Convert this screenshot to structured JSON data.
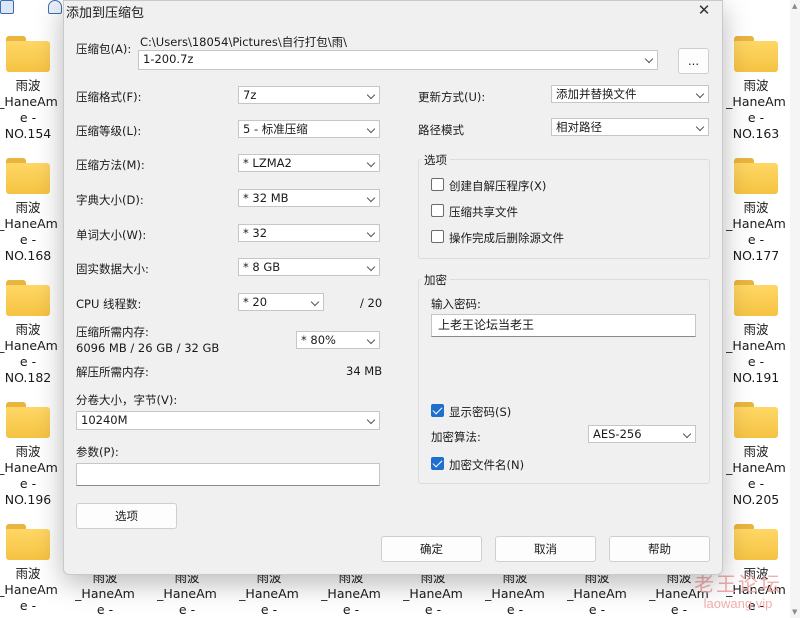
{
  "desktop": {
    "folders": [
      {
        "name": "雨波\n_HaneAm\ne -\nNO.154"
      },
      {
        "name": "雨波\n_HaneAm\ne -\nNO.168"
      },
      {
        "name": "雨波\n_HaneAm\ne -\nNO.182"
      },
      {
        "name": "雨波\n_HaneAm\ne -\nNO.196"
      },
      {
        "name": "雨波\n_HaneAm\ne -"
      },
      {
        "name": "雨波\n_HaneAm\ne -\nNO.163"
      },
      {
        "name": "雨波\n_HaneAm\ne -\nNO.177"
      },
      {
        "name": "雨波\n_HaneAm\ne -\nNO.191"
      },
      {
        "name": "雨波\n_HaneAm\ne -\nNO.205"
      },
      {
        "name": "雨波\n_HaneAm\ne -"
      }
    ],
    "bottom_row": [
      "雨波\n_HaneAm\ne -",
      "雨波\n_HaneAm\ne -",
      "雨波\n_HaneAm\ne -",
      "雨波\n_HaneAm\ne -",
      "雨波\n_HaneAm\ne -",
      "雨波\n_HaneAm\ne -",
      "雨波\n_HaneAm\ne -",
      "雨波\n_HaneAm\ne -"
    ],
    "watermark": {
      "line1": "老王论坛",
      "line2": "laowang.vip"
    }
  },
  "dialog": {
    "title": "添加到压缩包",
    "archive_label": "压缩包(A):",
    "archive_path": "C:\\Users\\18054\\Pictures\\自行打包\\雨\\",
    "archive_name": "1-200.7z",
    "browse_label": "...",
    "format_label": "压缩格式(F):",
    "format_value": "7z",
    "level_label": "压缩等级(L):",
    "level_value": "5 - 标准压缩",
    "method_label": "压缩方法(M):",
    "method_value": "*  LZMA2",
    "dict_label": "字典大小(D):",
    "dict_value": "*  32 MB",
    "word_label": "单词大小(W):",
    "word_value": "*  32",
    "solid_label": "固实数据大小:",
    "solid_value": "*  8 GB",
    "cpu_label": "CPU 线程数:",
    "cpu_value": "*  20",
    "cpu_total": "/ 20",
    "mem_comp_label": "压缩所需内存:",
    "mem_comp_value": "6096 MB / 26 GB / 32 GB",
    "mem_percent": "*  80%",
    "mem_decomp_label": "解压所需内存:",
    "mem_decomp_value": "34 MB",
    "split_label": "分卷大小，字节(V):",
    "split_value": "10240M",
    "params_label": "参数(P):",
    "params_value": "",
    "options_button": "选项",
    "update_label": "更新方式(U):",
    "update_value": "添加并替换文件",
    "path_label": "路径模式",
    "path_value": "相对路径",
    "options_group": {
      "title": "选项",
      "sfx": {
        "label": "创建自解压程序(X)",
        "checked": false
      },
      "shared": {
        "label": "压缩共享文件",
        "checked": false
      },
      "delete": {
        "label": "操作完成后删除源文件",
        "checked": false
      }
    },
    "encrypt_group": {
      "title": "加密",
      "password_label": "输入密码:",
      "password_value": "上老王论坛当老王",
      "show_password": {
        "label": "显示密码(S)",
        "checked": true
      },
      "method_label": "加密算法:",
      "method_value": "AES-256",
      "encrypt_names": {
        "label": "加密文件名(N)",
        "checked": true
      }
    },
    "ok_button": "确定",
    "cancel_button": "取消",
    "help_button": "帮助"
  }
}
